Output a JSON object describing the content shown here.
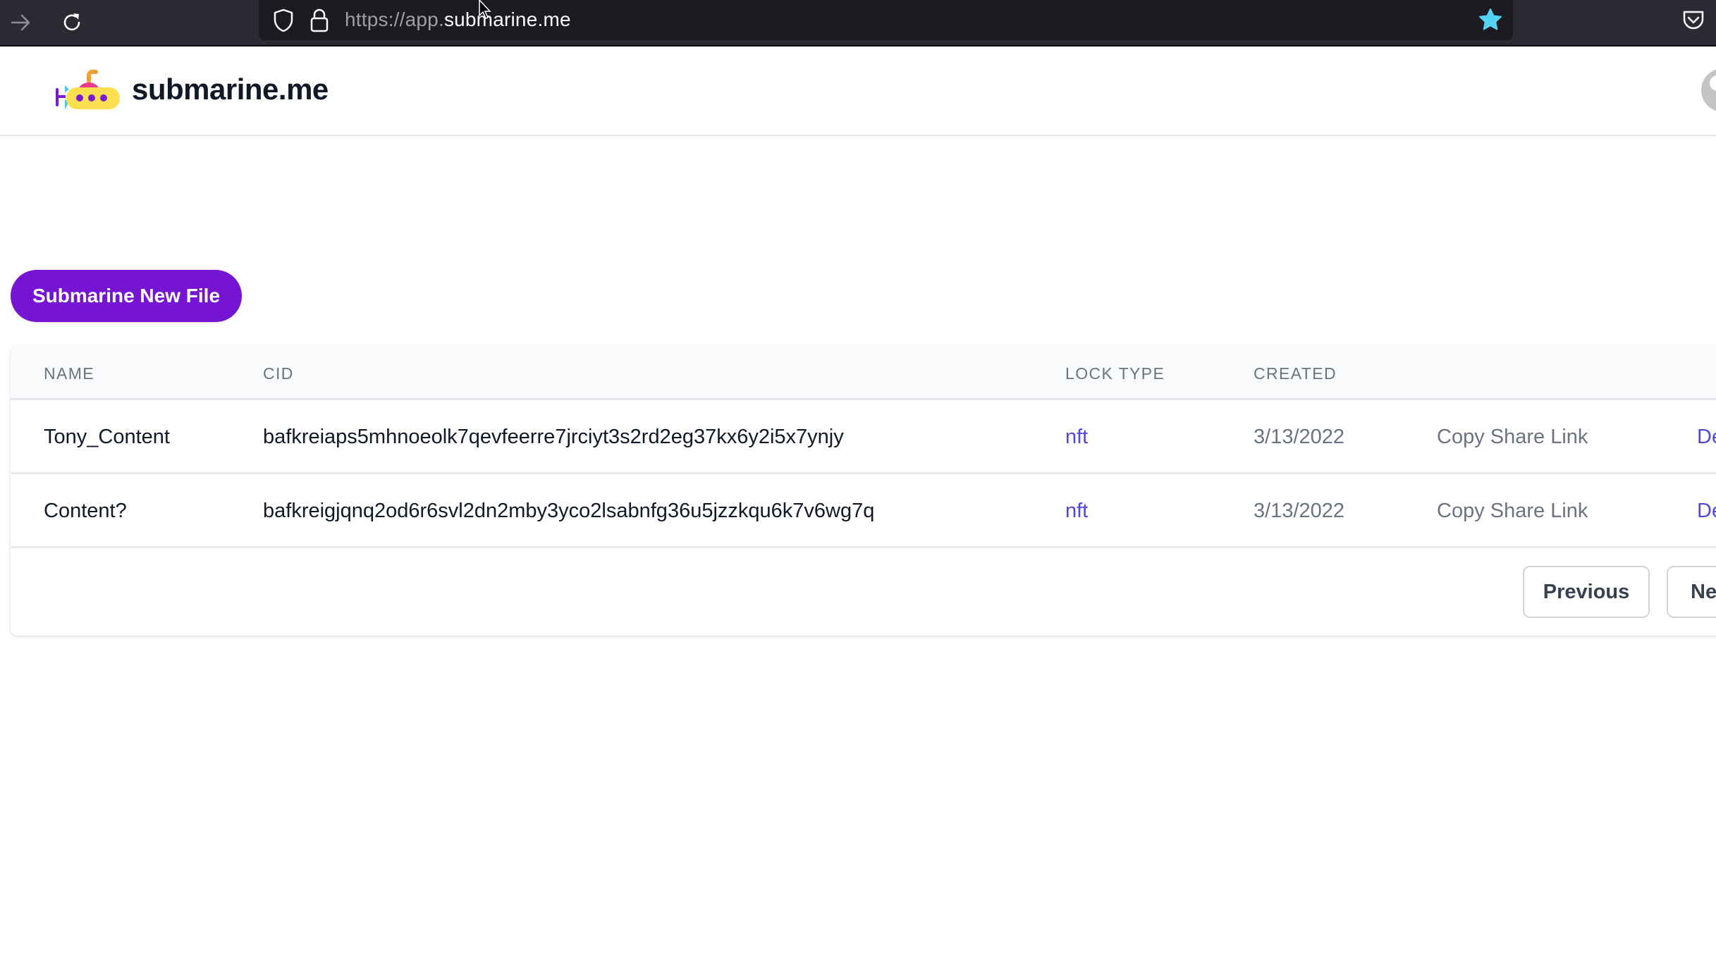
{
  "browser": {
    "url_scheme_host_prefix": "https://app.",
    "url_domain": "submarine.me",
    "icons": [
      "forward-arrow-icon",
      "reload-icon",
      "shield-icon",
      "lock-icon",
      "bookmark-star-icon",
      "pocket-icon"
    ],
    "star_color": "#54d1f5"
  },
  "header": {
    "logo_text": "submarine.me"
  },
  "main": {
    "new_file_button": "Submarine New File",
    "accent_color": "#7515d3"
  },
  "table": {
    "columns": [
      "NAME",
      "CID",
      "LOCK TYPE",
      "CREATED"
    ],
    "rows": [
      {
        "name": "Tony_Content",
        "cid": "bafkreiaps5mhnoeolk7qevfeerre7jrciyt3s2rd2eg37kx6y2i5x7ynjy",
        "lock_type": "nft",
        "created": "3/13/2022",
        "share_action": "Copy Share Link",
        "delete_action": "Delete"
      },
      {
        "name": "Content?",
        "cid": "bafkreigjqnq2od6r6svl2dn2mby3yco2lsabnfg36u5jzzkqu6k7v6wg7q",
        "lock_type": "nft",
        "created": "3/13/2022",
        "share_action": "Copy Share Link",
        "delete_action": "Delete"
      }
    ]
  },
  "pagination": {
    "previous": "Previous",
    "next": "Next"
  }
}
